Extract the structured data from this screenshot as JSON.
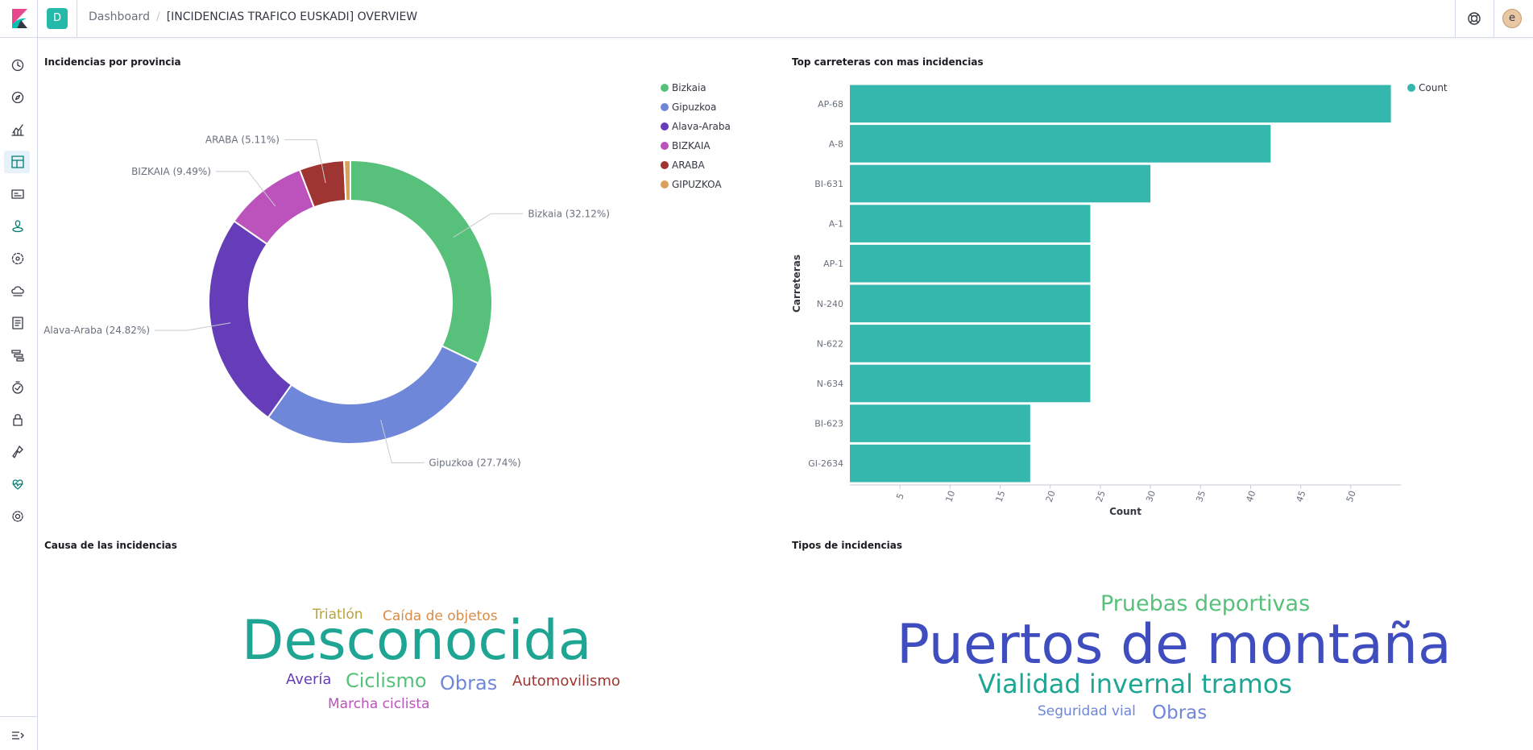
{
  "app": {
    "space_initial": "D",
    "user_initial": "e",
    "breadcrumb": [
      "Dashboard",
      "[INCIDENCIAS TRAFICO EUSKADI] OVERVIEW"
    ],
    "colors": {
      "accent": "#25b9a9",
      "brand_pink": "#e8488b",
      "brand_teal": "#00bfb3",
      "brand_dark": "#343741"
    },
    "sidebar_icons": [
      "clock-icon",
      "compass-icon",
      "visualize-icon",
      "dashboard-icon",
      "canvas-icon",
      "maps-icon",
      "ml-icon",
      "infrastructure-icon",
      "logs-icon",
      "apm-icon",
      "uptime-icon",
      "siem-icon",
      "devtools-icon",
      "monitoring-icon",
      "management-icon"
    ],
    "collapse_icon": "collapse-nav-icon"
  },
  "panels": {
    "pie": {
      "title": "Incidencias por provincia"
    },
    "bar": {
      "title": "Top carreteras con mas incidencias"
    },
    "cloud1": {
      "title": "Causa de las incidencias"
    },
    "cloud2": {
      "title": "Tipos de incidencias"
    }
  },
  "chart_data": [
    {
      "type": "pie",
      "donut": true,
      "title": "Incidencias por provincia",
      "slices": [
        {
          "label": "Bizkaia",
          "percent": 32.12,
          "color": "#57c17b",
          "callout": "Bizkaia (32.12%)"
        },
        {
          "label": "Gipuzkoa",
          "percent": 27.74,
          "color": "#6f87d8",
          "callout": "Gipuzkoa (27.74%)"
        },
        {
          "label": "Alava-Araba",
          "percent": 24.82,
          "color": "#663db8",
          "callout": "Alava-Araba (24.82%)"
        },
        {
          "label": "BIZKAIA",
          "percent": 9.49,
          "color": "#bc52bc",
          "callout": "BIZKAIA (9.49%)"
        },
        {
          "label": "ARABA",
          "percent": 5.11,
          "color": "#9e3533",
          "callout": "ARABA (5.11%)"
        },
        {
          "label": "GIPUZKOA",
          "percent": 0.72,
          "color": "#daa05d",
          "callout": ""
        }
      ],
      "legend_position": "top-right"
    },
    {
      "type": "bar",
      "orientation": "horizontal",
      "title": "Top carreteras con mas incidencias",
      "categories": [
        "AP-68",
        "A-8",
        "BI-631",
        "A-1",
        "AP-1",
        "N-240",
        "N-622",
        "N-634",
        "BI-623",
        "GI-2634"
      ],
      "series": [
        {
          "name": "Count",
          "color": "#34b7ad",
          "values": [
            54,
            42,
            30,
            24,
            24,
            24,
            24,
            24,
            18,
            18
          ]
        }
      ],
      "xlabel": "Count",
      "ylabel": "Carreteras",
      "xlim": [
        0,
        55
      ],
      "xticks": [
        5,
        10,
        15,
        20,
        25,
        30,
        35,
        40,
        45,
        50
      ],
      "grid": false,
      "legend_position": "top-right"
    },
    {
      "type": "wordcloud",
      "title": "Causa de las incidencias",
      "words": [
        {
          "text": "Desconocida",
          "color": "#1ea593"
        },
        {
          "text": "Triatlón",
          "color": "#b9a33c"
        },
        {
          "text": "Caída de objetos",
          "color": "#da8b45"
        },
        {
          "text": "Avería",
          "color": "#663db8"
        },
        {
          "text": "Ciclismo",
          "color": "#57c17b"
        },
        {
          "text": "Obras",
          "color": "#6f87d8"
        },
        {
          "text": "Automovilismo",
          "color": "#9e3533"
        },
        {
          "text": "Marcha ciclista",
          "color": "#bc52bc"
        }
      ]
    },
    {
      "type": "wordcloud",
      "title": "Tipos de incidencias",
      "words": [
        {
          "text": "Puertos de montaña",
          "color": "#3f4dbf"
        },
        {
          "text": "Pruebas deportivas",
          "color": "#57c17b"
        },
        {
          "text": "Vialidad invernal tramos",
          "color": "#1ea593"
        },
        {
          "text": "Seguridad vial",
          "color": "#6f87d8"
        },
        {
          "text": "Obras",
          "color": "#6f87d8"
        }
      ]
    }
  ]
}
